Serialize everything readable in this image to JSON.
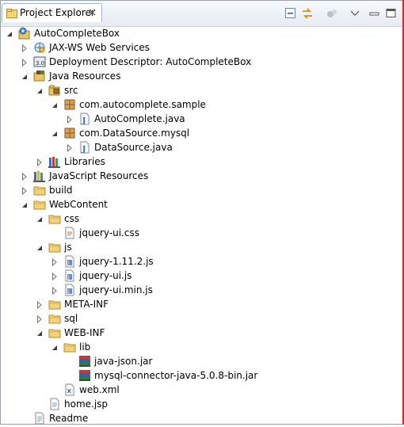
{
  "view": {
    "tab_label": "Project Explorer",
    "toolbar": [
      "collapse-all-icon",
      "link-with-editor-icon",
      "filters-icon",
      "view-menu-icon",
      "minimize-icon",
      "maximize-icon"
    ]
  },
  "tree": [
    {
      "label": "AutoCompleteBox",
      "depth": 0,
      "state": "expanded",
      "icon": "project-icon"
    },
    {
      "label": "JAX-WS Web Services",
      "depth": 1,
      "state": "collapsed",
      "icon": "webservices-icon"
    },
    {
      "label": "Deployment Descriptor: AutoCompleteBox",
      "depth": 1,
      "state": "collapsed",
      "icon": "deployment-descriptor-icon"
    },
    {
      "label": "Java Resources",
      "depth": 1,
      "state": "expanded",
      "icon": "java-resources-icon"
    },
    {
      "label": "src",
      "depth": 2,
      "state": "expanded",
      "icon": "source-folder-icon"
    },
    {
      "label": "com.autocomplete.sample",
      "depth": 3,
      "state": "expanded",
      "icon": "package-icon"
    },
    {
      "label": "AutoComplete.java",
      "depth": 4,
      "state": "collapsed",
      "icon": "java-file-icon"
    },
    {
      "label": "com.DataSource.mysql",
      "depth": 3,
      "state": "expanded",
      "icon": "package-icon"
    },
    {
      "label": "DataSource.java",
      "depth": 4,
      "state": "collapsed",
      "icon": "java-file-icon"
    },
    {
      "label": "Libraries",
      "depth": 2,
      "state": "collapsed",
      "icon": "libraries-icon"
    },
    {
      "label": "JavaScript Resources",
      "depth": 1,
      "state": "collapsed",
      "icon": "javascript-resources-icon"
    },
    {
      "label": "build",
      "depth": 1,
      "state": "collapsed",
      "icon": "folder-icon"
    },
    {
      "label": "WebContent",
      "depth": 1,
      "state": "expanded",
      "icon": "folder-icon"
    },
    {
      "label": "css",
      "depth": 2,
      "state": "expanded",
      "icon": "folder-icon"
    },
    {
      "label": "jquery-ui.css",
      "depth": 3,
      "state": "leaf",
      "icon": "css-file-icon"
    },
    {
      "label": "js",
      "depth": 2,
      "state": "expanded",
      "icon": "folder-icon"
    },
    {
      "label": "jquery-1.11.2.js",
      "depth": 3,
      "state": "collapsed",
      "icon": "js-file-icon"
    },
    {
      "label": "jquery-ui.js",
      "depth": 3,
      "state": "collapsed",
      "icon": "js-file-icon"
    },
    {
      "label": "jquery-ui.min.js",
      "depth": 3,
      "state": "collapsed",
      "icon": "js-file-icon"
    },
    {
      "label": "META-INF",
      "depth": 2,
      "state": "collapsed",
      "icon": "folder-icon"
    },
    {
      "label": "sql",
      "depth": 2,
      "state": "collapsed",
      "icon": "folder-icon"
    },
    {
      "label": "WEB-INF",
      "depth": 2,
      "state": "expanded",
      "icon": "folder-icon"
    },
    {
      "label": "lib",
      "depth": 3,
      "state": "expanded",
      "icon": "folder-icon"
    },
    {
      "label": "java-json.jar",
      "depth": 4,
      "state": "leaf",
      "icon": "jar-icon"
    },
    {
      "label": "mysql-connector-java-5.0.8-bin.jar",
      "depth": 4,
      "state": "leaf",
      "icon": "jar-icon"
    },
    {
      "label": "web.xml",
      "depth": 3,
      "state": "leaf",
      "icon": "xml-file-icon"
    },
    {
      "label": "home.jsp",
      "depth": 2,
      "state": "leaf",
      "icon": "jsp-file-icon"
    },
    {
      "label": "Readme",
      "depth": 1,
      "state": "leaf",
      "icon": "text-file-icon"
    }
  ]
}
